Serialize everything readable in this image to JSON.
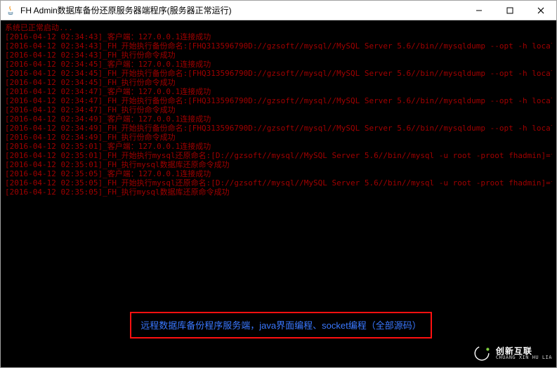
{
  "window": {
    "title": "FH Admin数据库备份还原服务器端程序(服务器正常运行)"
  },
  "console": {
    "lines": [
      "系统已正常启动...",
      "[2016-04-12 02:34:43]_客户端：127.0.0.1连接成功",
      "[2016-04-12 02:34:43]_FH_开始执行备份命名:[FHQ313596790D://gzsoft//mysql//MySQL Server 5.6//bin//mysqldump --opt -h localhost --",
      "[2016-04-12 02:34:43]_FH_执行份命令成功",
      "[2016-04-12 02:34:45]_客户端：127.0.0.1连接成功",
      "[2016-04-12 02:34:45]_FH_开始执行备份命名:[FHQ313596790D://gzsoft//mysql//MySQL Server 5.6//bin//mysqldump --opt -h localhost --",
      "[2016-04-12 02:34:45]_FH_执行份命令成功",
      "[2016-04-12 02:34:47]_客户端：127.0.0.1连接成功",
      "[2016-04-12 02:34:47]_FH_开始执行备份命名:[FHQ313596790D://gzsoft//mysql//MySQL Server 5.6//bin//mysqldump --opt -h localhost --",
      "[2016-04-12 02:34:47]_FH_执行份命令成功",
      "[2016-04-12 02:34:49]_客户端：127.0.0.1连接成功",
      "[2016-04-12 02:34:49]_FH_开始执行备份命名:[FHQ313596790D://gzsoft//mysql//MySQL Server 5.6//bin//mysqldump --opt -h localhost --",
      "[2016-04-12 02:34:49]_FH_执行份命令成功",
      "[2016-04-12 02:35:01]_客户端：127.0.0.1连接成功",
      "[2016-04-12 02:35:01]_FH_开始执行mysql还原命名:[D://gzsoft//mysql//MySQL Server 5.6//bin//mysql -u root -proot fhadmin]=f:/mysql_",
      "[2016-04-12 02:35:01]_FH_执行mysql数据库还原命令成功",
      "[2016-04-12 02:35:05]_客户端：127.0.0.1连接成功",
      "[2016-04-12 02:35:05]_FH_开始执行mysql还原命名:[D://gzsoft//mysql//MySQL Server 5.6//bin//mysql -u root -proot fhadmin]=f:/mysql_",
      "[2016-04-12 02:35:05]_FH_执行mysql数据库还原命令成功"
    ]
  },
  "banner": {
    "text": "远程数据库备份程序服务端，java界面编程、socket编程（全部源码）"
  },
  "watermark": {
    "cn": "创新互联",
    "en": "CHUANG XIN HU LIA"
  }
}
